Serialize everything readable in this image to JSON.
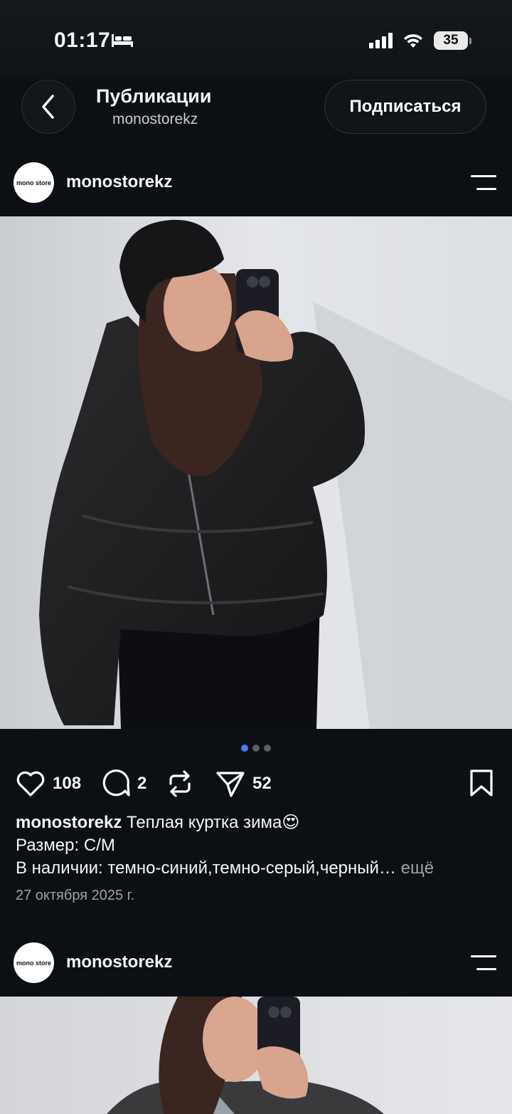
{
  "status_bar": {
    "time": "01:17",
    "battery": "35"
  },
  "header": {
    "title": "Публикации",
    "subtitle": "monostorekz",
    "follow_label": "Подписаться"
  },
  "posts": [
    {
      "avatar_text": "mono store",
      "username": "monostorekz",
      "carousel": {
        "count": 3,
        "active": 0
      },
      "likes": "108",
      "comments": "2",
      "shares": "52",
      "caption_user": "monostorekz",
      "caption_line1": "Теплая куртка зима😍",
      "caption_line2": "Размер: С/М",
      "caption_line3": "В наличии: темно-синий,темно-серый,черный…",
      "more_label": "ещё",
      "date": "27 октября 2025 г."
    },
    {
      "avatar_text": "mono store",
      "username": "monostorekz"
    }
  ],
  "icons": {
    "back": "chevron-left-icon",
    "bed": "bed-icon",
    "signal": "cellular-signal-icon",
    "wifi": "wifi-icon",
    "menu": "menu-lines-icon",
    "like": "heart-icon",
    "comment": "comment-bubble-icon",
    "repost": "repost-icon",
    "share": "paper-plane-icon",
    "save": "bookmark-icon"
  },
  "colors": {
    "background": "#0c1014",
    "accent_dot": "#4a7bf7"
  }
}
